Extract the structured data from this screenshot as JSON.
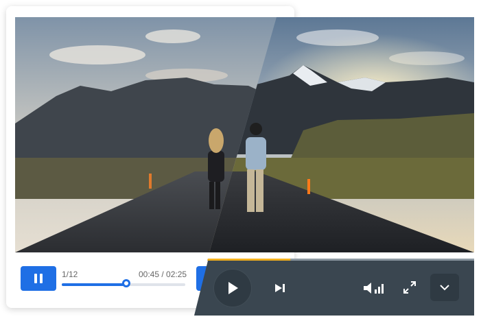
{
  "light_player": {
    "counter": "1/12",
    "time": "00:45 / 02:25",
    "progress": 0.52
  },
  "dark_player": {
    "progress": 0.31
  },
  "icons": {
    "pause": "pause-icon",
    "play": "play-icon",
    "next": "skip-next-icon",
    "volume": "volume-icon",
    "fullscreen": "fullscreen-icon",
    "menu": "chevron-down-icon"
  },
  "colors": {
    "accent": "#1f6fe5",
    "dark_panel": "#3a4650",
    "dark_progress": "#f2b01e"
  }
}
